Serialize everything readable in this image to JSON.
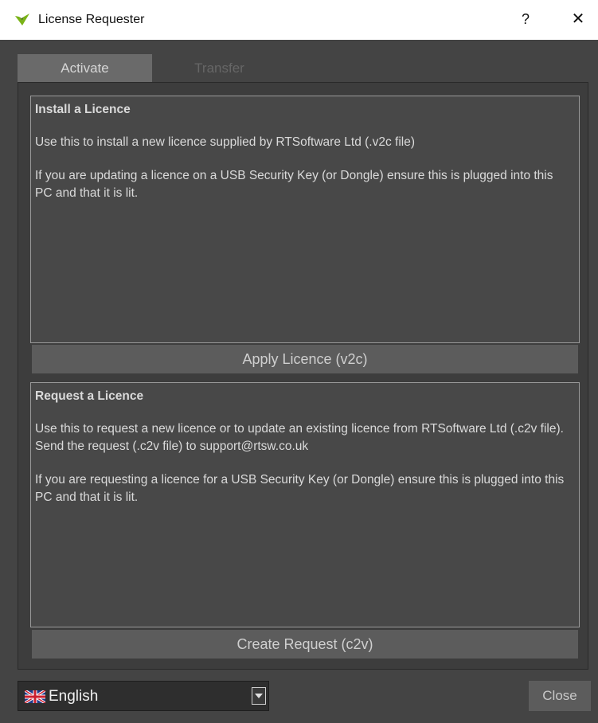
{
  "window": {
    "title": "License Requester",
    "help_label": "?",
    "close_label": "✕"
  },
  "tabs": [
    {
      "label": "Activate",
      "active": true
    },
    {
      "label": "Transfer",
      "active": false
    }
  ],
  "install": {
    "heading": "Install a Licence",
    "text1": "Use this to install a new licence supplied by RTSoftware Ltd (.v2c file)",
    "text2": "If you are updating a licence on a USB Security Key (or Dongle) ensure this is plugged into this PC and that it is lit.",
    "button": "Apply Licence (v2c)"
  },
  "request": {
    "heading": "Request a Licence",
    "text1": "Use this to request a new licence or to update an existing licence from RTSoftware Ltd (.c2v file). Send the request (.c2v file) to support@rtsw.co.uk",
    "text2": "If you are requesting a licence for a USB Security Key (or Dongle) ensure this is plugged into this PC and that it is lit.",
    "button": "Create Request (c2v)"
  },
  "language": {
    "selected": "English",
    "flag_icon": "uk-flag-icon"
  },
  "footer": {
    "close_button": "Close"
  },
  "colors": {
    "background": "#444444",
    "titlebar": "#ffffff",
    "button": "#5c5c5c",
    "accent_green": "#7ab317"
  }
}
